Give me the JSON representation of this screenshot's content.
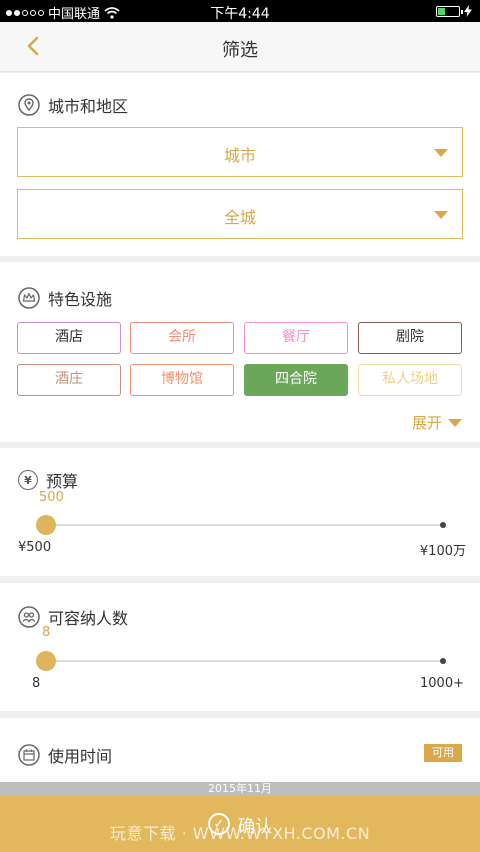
{
  "status_bar": {
    "carrier": "中国联通",
    "time": "下午4:44"
  },
  "nav": {
    "title": "筛选"
  },
  "city_section": {
    "title": "城市和地区",
    "city_dropdown": "城市",
    "district_dropdown": "全城"
  },
  "facilities_section": {
    "title": "特色设施",
    "tags": [
      {
        "label": "酒店",
        "color": "#c98fd6",
        "text_color": "#333333",
        "selected": false
      },
      {
        "label": "会所",
        "color": "#ef8f7c",
        "text_color": "#ef8f7c",
        "selected": false
      },
      {
        "label": "餐厅",
        "color": "#f28fcf",
        "text_color": "#f28fcf",
        "selected": false
      },
      {
        "label": "剧院",
        "color": "#8a5a52",
        "text_color": "#333333",
        "selected": false
      },
      {
        "label": "酒庄",
        "color": "#c98f7a",
        "text_color": "#c98f7a",
        "selected": false
      },
      {
        "label": "博物馆",
        "color": "#f3936a",
        "text_color": "#f3936a",
        "selected": false
      },
      {
        "label": "四合院",
        "color": "#6aa75a",
        "text_color": "#ffffff",
        "selected": true
      },
      {
        "label": "私人场地",
        "color": "#f3dca3",
        "text_color": "#f0d089",
        "selected": false
      }
    ],
    "expand_label": "展开"
  },
  "budget_section": {
    "title": "预算",
    "icon_glyph": "¥",
    "current_value": "500",
    "min_label": "¥500",
    "max_label": "¥100万",
    "position": 0
  },
  "capacity_section": {
    "title": "可容纳人数",
    "current_value": "8",
    "min_label": "8",
    "max_label": "1000+",
    "position": 0
  },
  "time_section": {
    "title": "使用时间",
    "badge": "可用"
  },
  "date_strip": "2015年11月",
  "confirm_button": {
    "label": "确认"
  },
  "watermark": "玩意下载 · WWW.WYXH.COM.CN",
  "colors": {
    "accent": "#d9a84a",
    "confirm_bg": "#e3b85c"
  }
}
